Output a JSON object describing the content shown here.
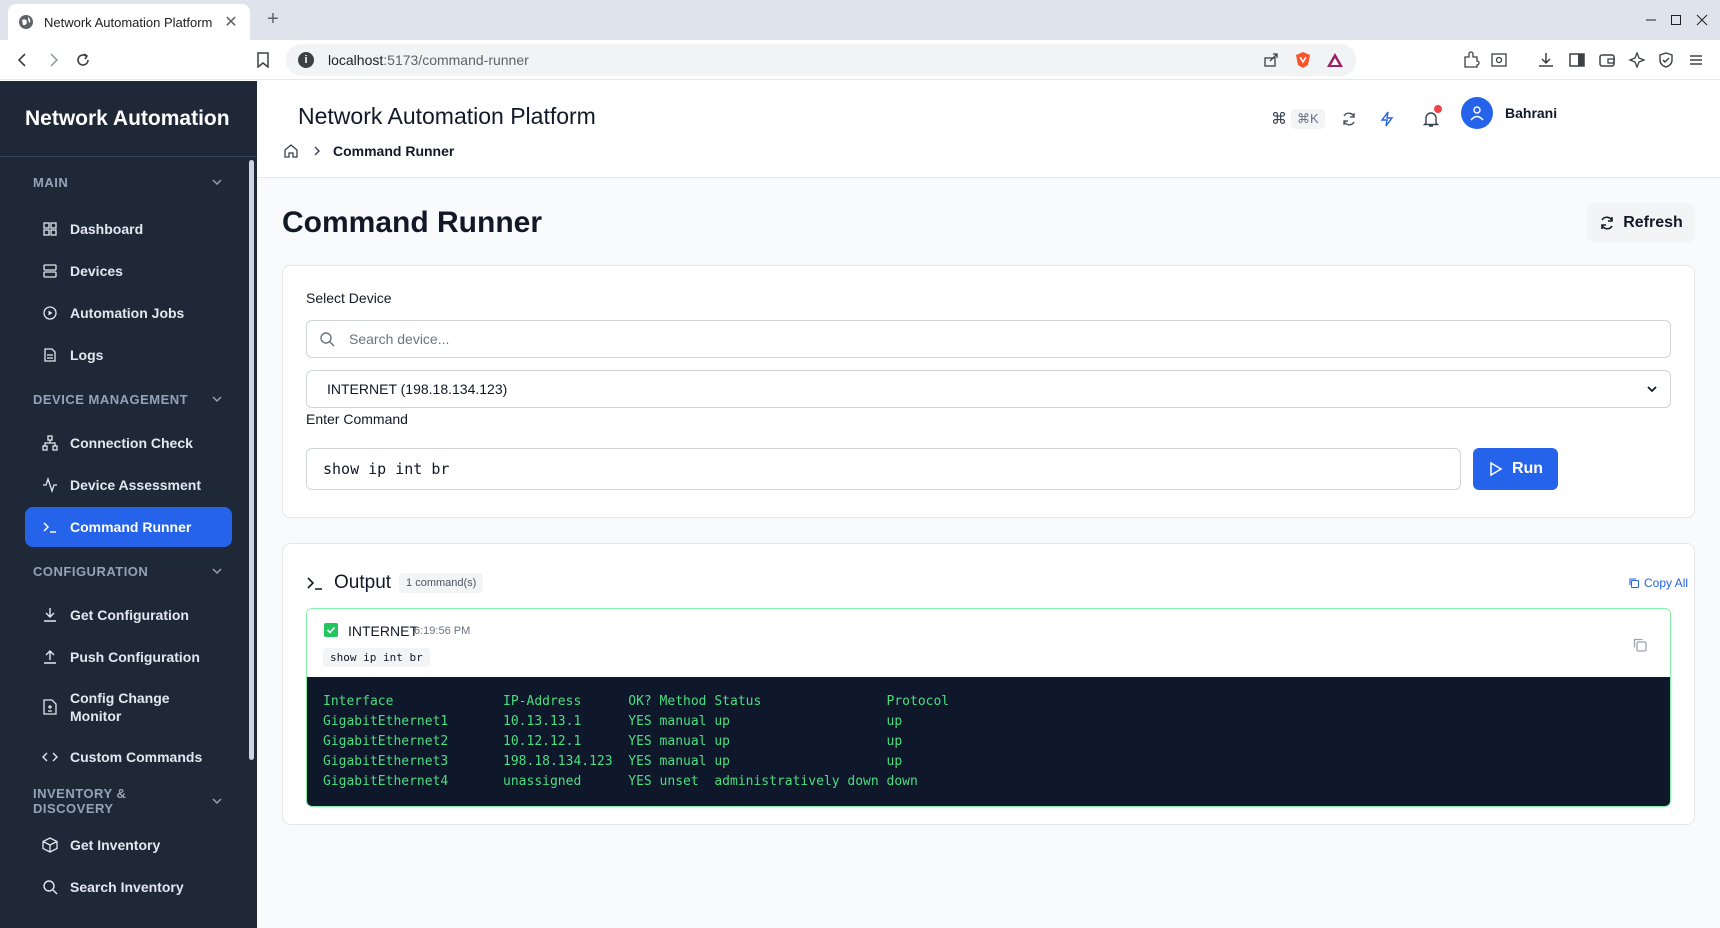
{
  "browser": {
    "tab_title": "Network Automation Platform",
    "url_host": "localhost",
    "url_rest": ":5173/command-runner"
  },
  "sidebar": {
    "brand": "Network Automation",
    "sections": [
      {
        "title": "MAIN",
        "items": [
          {
            "label": "Dashboard",
            "icon": "dashboard-icon"
          },
          {
            "label": "Devices",
            "icon": "server-icon"
          },
          {
            "label": "Automation Jobs",
            "icon": "play-circle-icon"
          },
          {
            "label": "Logs",
            "icon": "file-text-icon"
          }
        ]
      },
      {
        "title": "DEVICE MANAGEMENT",
        "items": [
          {
            "label": "Connection Check",
            "icon": "network-icon"
          },
          {
            "label": "Device Assessment",
            "icon": "activity-icon"
          },
          {
            "label": "Command Runner",
            "icon": "terminal-icon"
          }
        ]
      },
      {
        "title": "CONFIGURATION",
        "items": [
          {
            "label": "Get Configuration",
            "icon": "download-icon"
          },
          {
            "label": "Push Configuration",
            "icon": "upload-icon"
          },
          {
            "label": "Config Change Monitor",
            "label_line1": "Config Change",
            "label_line2": "Monitor",
            "icon": "file-diff-icon"
          },
          {
            "label": "Custom Commands",
            "icon": "code-icon"
          }
        ]
      },
      {
        "title": "INVENTORY & DISCOVERY",
        "items": [
          {
            "label": "Get Inventory",
            "icon": "package-icon"
          },
          {
            "label": "Search Inventory",
            "icon": "search-icon"
          }
        ]
      }
    ],
    "active": "Command Runner"
  },
  "header": {
    "title": "Network Automation Platform",
    "breadcrumb_current": "Command Runner",
    "shortcut": "⌘K",
    "user": "Bahrani"
  },
  "page": {
    "title": "Command Runner",
    "refresh_label": "Refresh",
    "select_device_label": "Select Device",
    "search_placeholder": "Search device...",
    "selected_device": "INTERNET (198.18.134.123)",
    "enter_command_label": "Enter Command",
    "command_value": "show ip int br",
    "run_label": "Run"
  },
  "output": {
    "title": "Output",
    "count_badge": "1 command(s)",
    "copy_all_label": "Copy All",
    "result": {
      "device": "INTERNET",
      "time": "6:19:56 PM",
      "command": "show ip int br",
      "text": "Interface              IP-Address      OK? Method Status                Protocol\nGigabitEthernet1       10.13.13.1      YES manual up                    up\nGigabitEthernet2       10.12.12.1      YES manual up                    up\nGigabitEthernet3       198.18.134.123  YES manual up                    up\nGigabitEthernet4       unassigned      YES unset  administratively down down"
    }
  },
  "colors": {
    "sidebar_bg": "#1e2837",
    "accent": "#2563eb",
    "terminal_bg": "#0f172a",
    "terminal_text": "#4ade80",
    "success": "#22c55e"
  }
}
